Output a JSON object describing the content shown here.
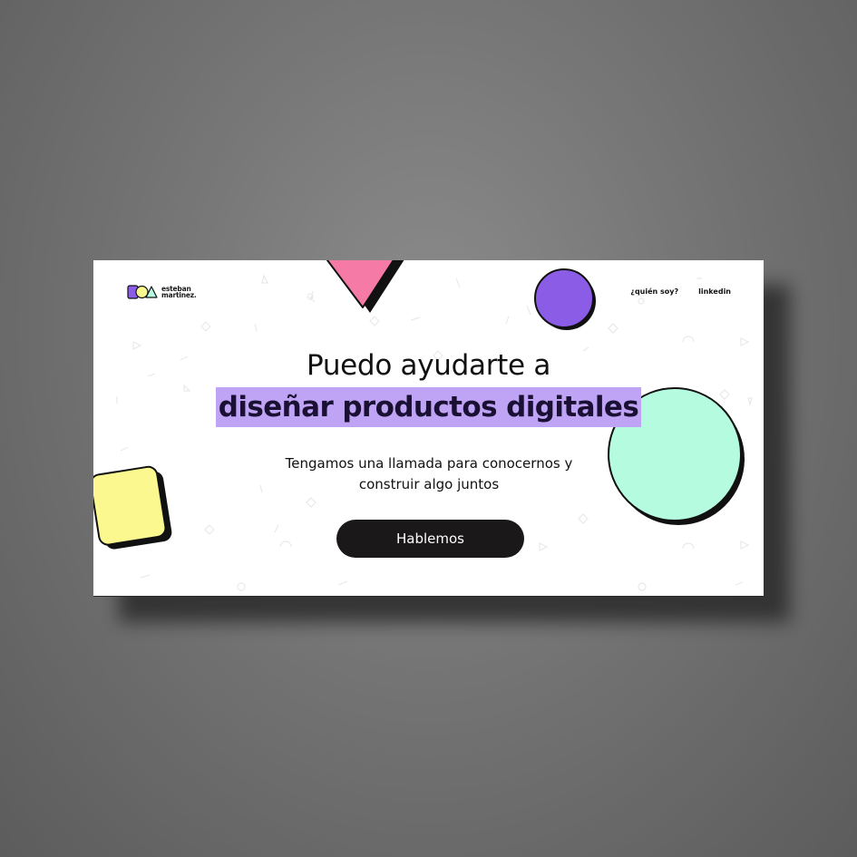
{
  "brand": {
    "name_line1": "esteban",
    "name_line2": "martinez."
  },
  "nav": {
    "items": [
      {
        "label": "¿quién soy?"
      },
      {
        "label": "linkedin"
      }
    ]
  },
  "hero": {
    "line1": "Puedo ayudarte a",
    "highlight": "diseñar productos digitales",
    "subtitle_line1": "Tengamos una llamada para conocernos y",
    "subtitle_line2": "construir algo juntos",
    "cta_label": "Hablemos"
  },
  "colors": {
    "background": "#777777",
    "page": "#ffffff",
    "highlight": "#bfa4f5",
    "pink": "#f57aa6",
    "purple": "#8b5ce6",
    "mint": "#b4fbe0",
    "yellow": "#faf88e",
    "button": "#1a1818",
    "text": "#111111"
  },
  "decorations": [
    "pink-triangle",
    "purple-circle",
    "mint-circle",
    "yellow-square"
  ]
}
